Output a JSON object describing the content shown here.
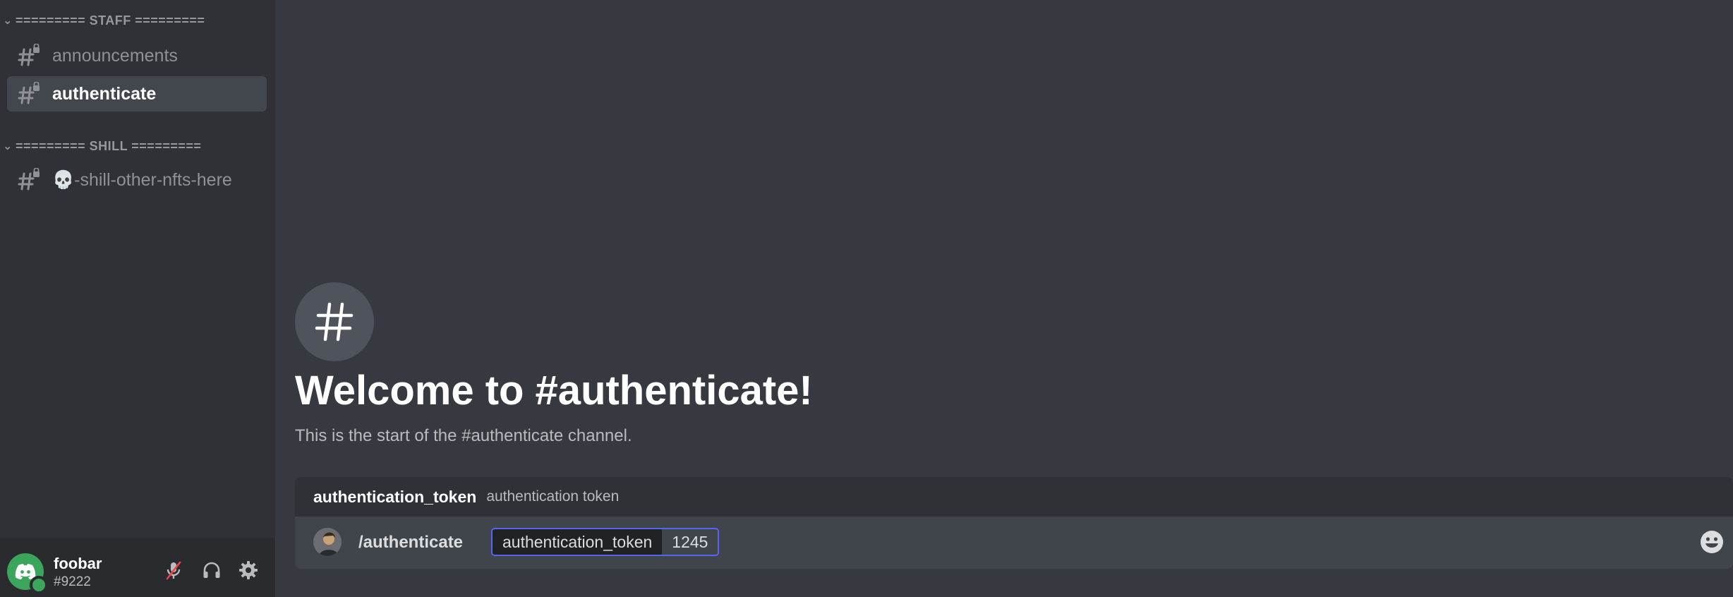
{
  "sidebar": {
    "categories": [
      {
        "label": "========= STAFF =========",
        "channels": [
          "announcements",
          "authenticate"
        ]
      },
      {
        "label": "========= SHILL =========",
        "channels": [
          "💀-shill-other-nfts-here"
        ]
      }
    ],
    "active_channel": "authenticate"
  },
  "user": {
    "name": "foobar",
    "tag": "#9222",
    "status": "online"
  },
  "main": {
    "welcome_title": "Welcome to #authenticate!",
    "welcome_sub": "This is the start of the #authenticate channel."
  },
  "command": {
    "option_name": "authentication_token",
    "option_desc": "authentication token",
    "name": "/authenticate",
    "param_label": "authentication_token",
    "param_value": "1245"
  },
  "icons": {
    "channel": "locked-hash-icon",
    "mute": "mic-muted-icon",
    "deafen": "headphones-icon",
    "settings": "gear-icon",
    "emoji": "emoji-icon"
  },
  "colors": {
    "accent": "#5865f2",
    "online": "#3ba55c",
    "sidebar_bg": "#2f3136",
    "main_bg": "#36393f"
  }
}
